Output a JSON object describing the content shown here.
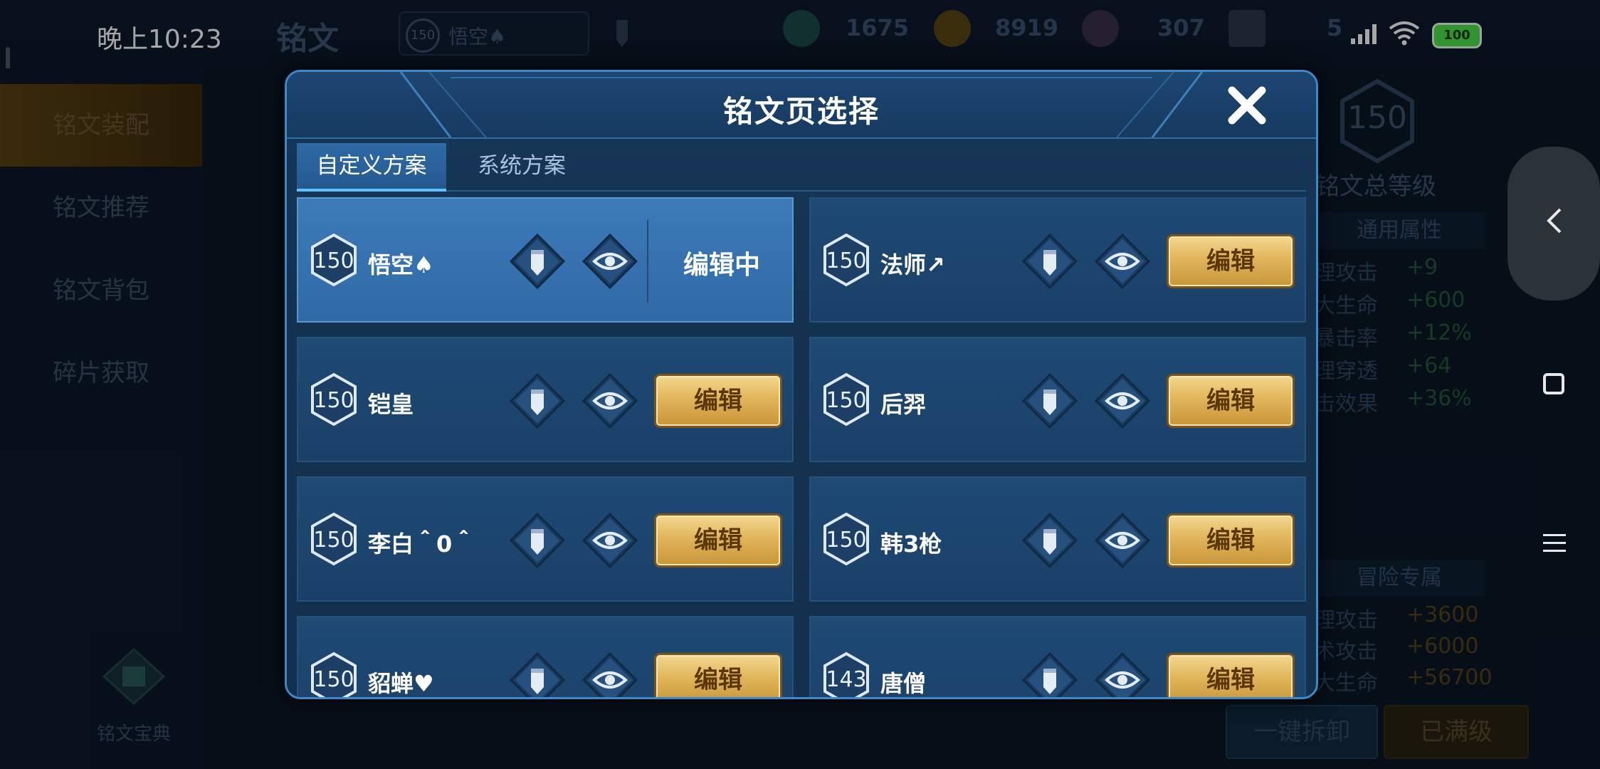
{
  "status_bar": {
    "time": "晚上10:23",
    "battery": "100"
  },
  "background": {
    "title": "铭文",
    "current_page": {
      "level": "150",
      "name": "悟空♠"
    },
    "resources": [
      "1675",
      "8919",
      "307",
      "5"
    ],
    "sidebar": [
      "铭文装配",
      "铭文推荐",
      "铭文背包",
      "碎片获取"
    ],
    "sidebar_bottom": "铭文宝典",
    "total_level": {
      "value": "150",
      "label": "铭文总等级"
    },
    "general_title": "通用属性",
    "general_stats": [
      {
        "k": "理攻击",
        "v": "+9"
      },
      {
        "k": "大生命",
        "v": "+600"
      },
      {
        "k": "暴击率",
        "v": "+12%"
      },
      {
        "k": "理穿透",
        "v": "+64"
      },
      {
        "k": "击效果",
        "v": "+36%"
      }
    ],
    "adventure_title": "冒险专属",
    "adventure_stats": [
      {
        "k": "理攻击",
        "v": "+3600"
      },
      {
        "k": "术攻击",
        "v": "+6000"
      },
      {
        "k": "大生命",
        "v": "+56700"
      }
    ],
    "buttons": {
      "unload": "一键拆卸",
      "maxed": "已满级"
    }
  },
  "modal": {
    "title": "铭文页选择",
    "tabs": {
      "custom": "自定义方案",
      "system": "系统方案"
    },
    "edit_label": "编辑",
    "editing_label": "编辑中",
    "pages": [
      {
        "level": "150",
        "name": "悟空♠"
      },
      {
        "level": "150",
        "name": "法师↗"
      },
      {
        "level": "150",
        "name": "铠皇"
      },
      {
        "level": "150",
        "name": "后羿"
      },
      {
        "level": "150",
        "name": "李白＾0＾"
      },
      {
        "level": "150",
        "name": "韩3枪"
      },
      {
        "level": "150",
        "name": "貂蝉♥"
      },
      {
        "level": "143",
        "name": "唐僧"
      }
    ]
  }
}
